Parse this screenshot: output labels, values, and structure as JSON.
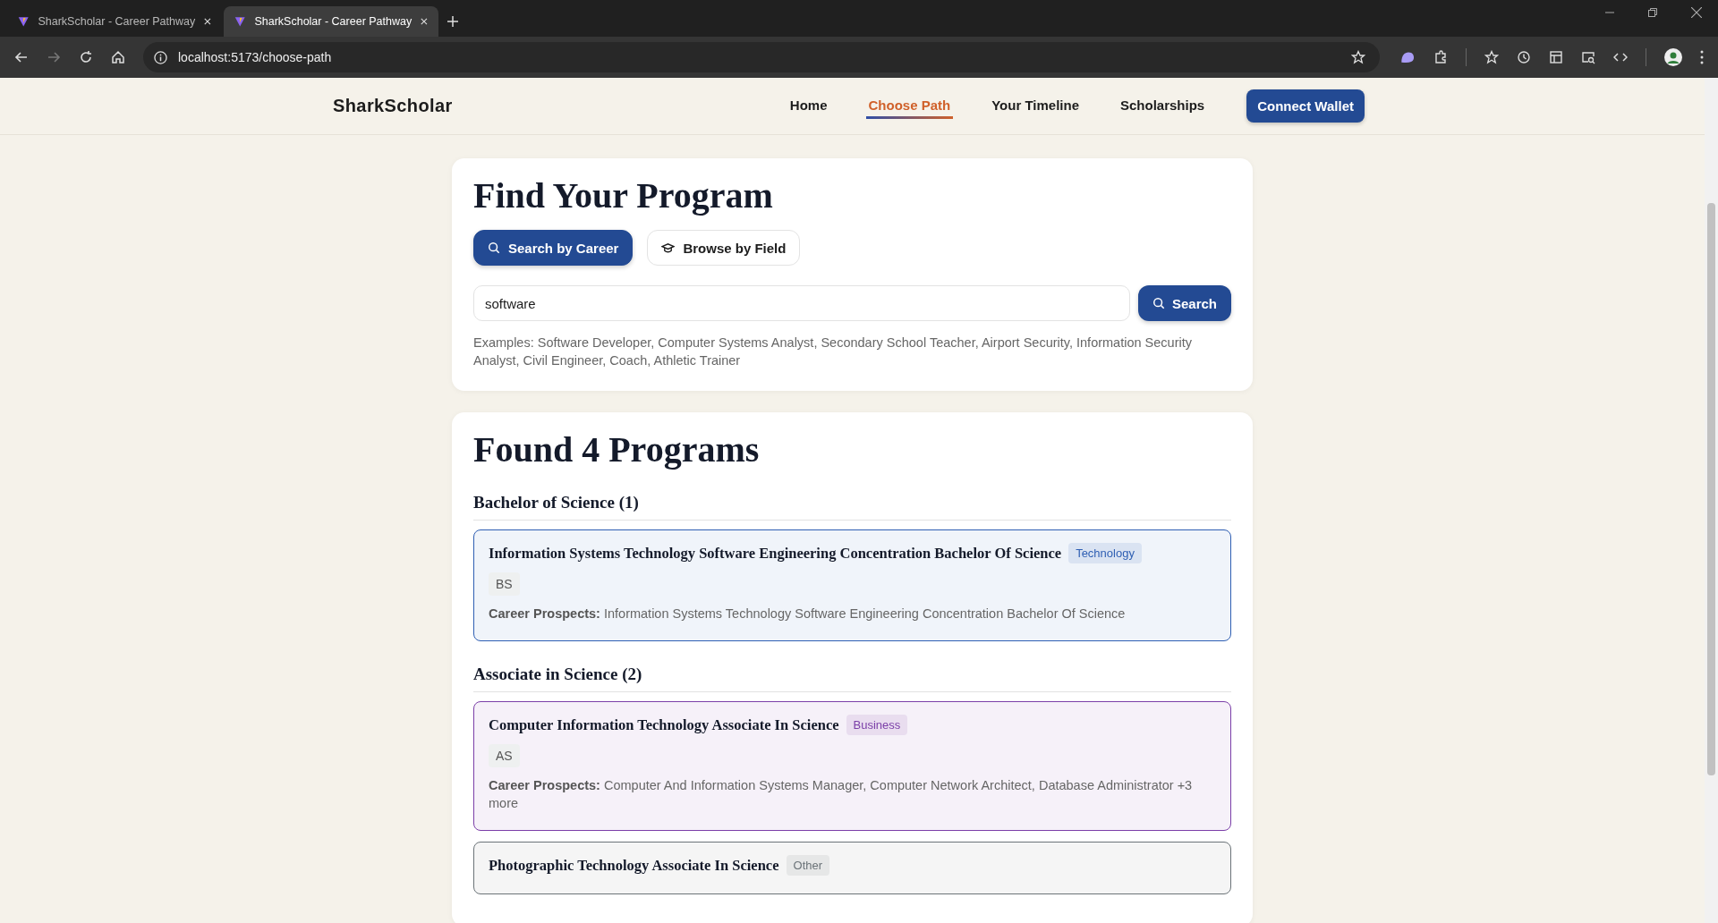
{
  "browser": {
    "tabs": [
      {
        "title": "SharkScholar - Career Pathway",
        "selected": false
      },
      {
        "title": "SharkScholar - Career Pathway",
        "selected": true
      }
    ],
    "url": "localhost:5173/choose-path"
  },
  "header": {
    "brand": "SharkScholar",
    "nav": [
      {
        "label": "Home",
        "selected": false
      },
      {
        "label": "Choose Path",
        "selected": true
      },
      {
        "label": "Your Timeline",
        "selected": false
      },
      {
        "label": "Scholarships",
        "selected": false
      }
    ],
    "connect_button": "Connect Wallet"
  },
  "search_card": {
    "title": "Find Your Program",
    "modes": [
      {
        "label": "Search by Career",
        "kind": "search",
        "selected": true
      },
      {
        "label": "Browse by Field",
        "kind": "field",
        "selected": false
      }
    ],
    "search_field": {
      "value": "software"
    },
    "search_button": "Search",
    "examples": "Examples: Software Developer, Computer Systems Analyst, Secondary School Teacher, Airport Security, Information Security Analyst, Civil Engineer, Coach, Athletic Trainer"
  },
  "results": {
    "title": "Found 4 Programs",
    "groups": [
      {
        "heading": "Bachelor of Science (1)",
        "programs": [
          {
            "name": "Information Systems Technology Software Engineering Concentration Bachelor Of Science",
            "category": "Technology",
            "color": "#2f5fb3",
            "degree": "BS",
            "prospects_label": "Career Prospects:",
            "prospects": "Information Systems Technology Software Engineering Concentration Bachelor Of Science"
          }
        ]
      },
      {
        "heading": "Associate in Science (2)",
        "programs": [
          {
            "name": "Computer Information Technology Associate In Science",
            "category": "Business",
            "color": "#7b3fa8",
            "degree": "AS",
            "prospects_label": "Career Prospects:",
            "prospects": "Computer And Information Systems Manager, Computer Network Architect, Database Administrator +3 more"
          },
          {
            "name": "Photographic Technology Associate In Science",
            "category": "Other",
            "color": "#6b7378"
          }
        ]
      }
    ]
  }
}
